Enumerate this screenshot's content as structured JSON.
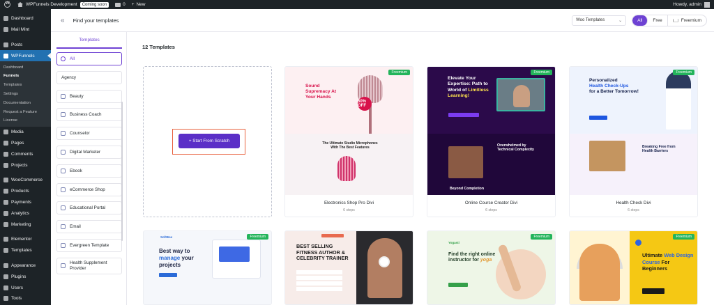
{
  "admin_bar": {
    "site_name": "WPFunnels Development",
    "coming_soon": "Coming soon",
    "comments_count": "0",
    "new_label": "New",
    "howdy": "Howdy, admin"
  },
  "sidebar": {
    "items_top": [
      {
        "label": "Dashboard",
        "icon": "dashboard-icon"
      },
      {
        "label": "Mail Mint",
        "icon": "mail-icon"
      }
    ],
    "items_mid": [
      {
        "label": "Posts",
        "icon": "pin-icon"
      },
      {
        "label": "WPFunnels",
        "icon": "funnel-icon"
      }
    ],
    "submenu": [
      "Dashboard",
      "Funnels",
      "Templates",
      "Settings",
      "Documentation",
      "Request a Feature",
      "License"
    ],
    "items_bottom": [
      {
        "label": "Media",
        "icon": "media-icon"
      },
      {
        "label": "Pages",
        "icon": "page-icon"
      },
      {
        "label": "Comments",
        "icon": "comment-icon"
      },
      {
        "label": "Projects",
        "icon": "pin-icon"
      }
    ],
    "items_commerce": [
      {
        "label": "WooCommerce",
        "icon": "woo-icon"
      },
      {
        "label": "Products",
        "icon": "box-icon"
      },
      {
        "label": "Payments",
        "icon": "payment-icon"
      },
      {
        "label": "Analytics",
        "icon": "chart-icon"
      },
      {
        "label": "Marketing",
        "icon": "megaphone-icon"
      }
    ],
    "items_tools": [
      {
        "label": "Elementor",
        "icon": "elementor-icon"
      },
      {
        "label": "Templates",
        "icon": "folder-icon"
      }
    ],
    "items_admin": [
      {
        "label": "Appearance",
        "icon": "brush-icon"
      },
      {
        "label": "Plugins",
        "icon": "plug-icon"
      },
      {
        "label": "Users",
        "icon": "user-icon"
      },
      {
        "label": "Tools",
        "icon": "wrench-icon"
      }
    ]
  },
  "header": {
    "title": "Find your templates",
    "builder_select": "Woo Templates",
    "filters": [
      "All",
      "Free",
      "Freemium"
    ]
  },
  "categories": {
    "heading": "Templates",
    "items": [
      "All",
      "Agency",
      "Beauty",
      "Business Coach",
      "Counselor",
      "Digital Marketer",
      "Ebook",
      "eCommerce Shop",
      "Educational Portal",
      "Email",
      "Evergreen Template",
      "Health Supplement Provider"
    ]
  },
  "content": {
    "count_label": "12 Templates",
    "scratch_button": "+ Start From Scratch",
    "freemium_badge": "Freemium",
    "cards": [
      {
        "name": "Electronics Shop Pro Divi",
        "steps": "6 steps"
      },
      {
        "name": "Online Course Creator Divi",
        "steps": "6 steps"
      },
      {
        "name": "Health Check Divi",
        "steps": "6 steps"
      }
    ],
    "previews": {
      "electronics": {
        "h1a": "Sound",
        "h1b": "Supremacy At",
        "h1c": "Your Hands",
        "discount": "50% OFF",
        "h2": "The Ultimate Studio Microphones With The Best Features"
      },
      "course": {
        "h1a": "Elevate Your",
        "h1b": "Expertise: Path to",
        "h1c": "World of",
        "h1hl": "Limitless Learning!",
        "h2": "Overwhelmed by Technical Complexity",
        "h3": "Beyond Completion"
      },
      "health": {
        "h1a": "Personalized",
        "h1b": "Health Check-Ups",
        "h1c": "for a Better Tomorrow!",
        "h2": "Breaking Free from Health Barriers"
      },
      "saas": {
        "logo": "SoftBox",
        "h1a": "Best way to",
        "h1b": "manage",
        "h1c": "your projects"
      },
      "fitness": {
        "h1": "BEST SELLING FITNESS AUTHOR & CELEBRITY TRAINER"
      },
      "yoga": {
        "logo": "Yogasti",
        "h1a": "Find the right online instructor for",
        "h1b": "yoga"
      },
      "webdesign": {
        "h1a": "Ultimate",
        "h1b": "Web Design Course",
        "h1c": "For Beginners"
      }
    }
  },
  "colors": {
    "accent": "#6e42d3",
    "wp_blue": "#2271b1",
    "freemium": "#23b45b",
    "highlight": "#e8623f"
  }
}
